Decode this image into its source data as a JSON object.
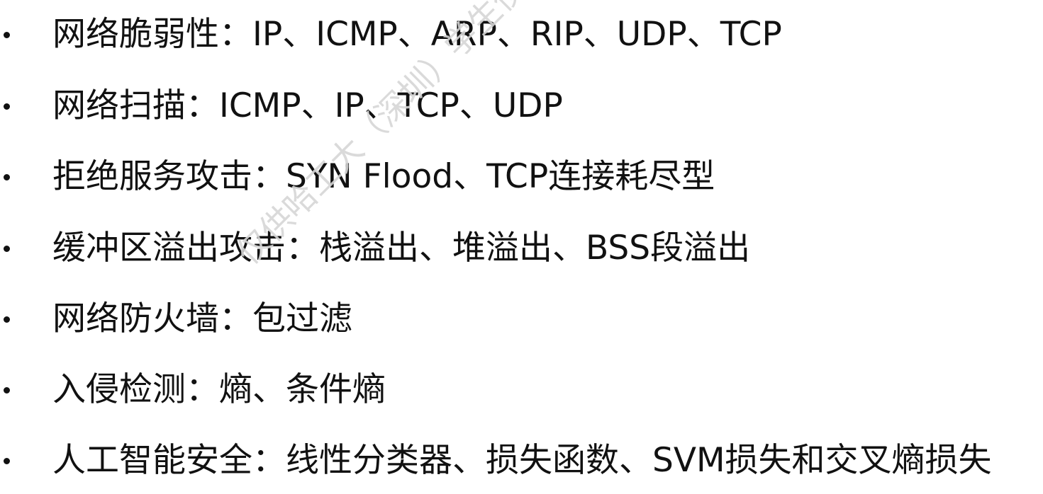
{
  "bullets": [
    {
      "text": "网络脆弱性：IP、ICMP、ARP、RIP、UDP、TCP"
    },
    {
      "text": "网络扫描：ICMP、IP、TCP、UDP"
    },
    {
      "text": "拒绝服务攻击：SYN Flood、TCP连接耗尽型"
    },
    {
      "text": "缓冲区溢出攻击：栈溢出、堆溢出、BSS段溢出"
    },
    {
      "text": "网络防火墙：包过滤"
    },
    {
      "text": "入侵检测：熵、条件熵"
    },
    {
      "text": "人工智能安全：线性分类器、损失函数、SVM损失和交叉熵损失"
    }
  ],
  "watermark": {
    "text": "仅供哈工大（深圳）学生使用，严禁外传"
  },
  "colors": {
    "text": "#111111",
    "watermark": "#d6d6d6",
    "background": "#ffffff"
  }
}
